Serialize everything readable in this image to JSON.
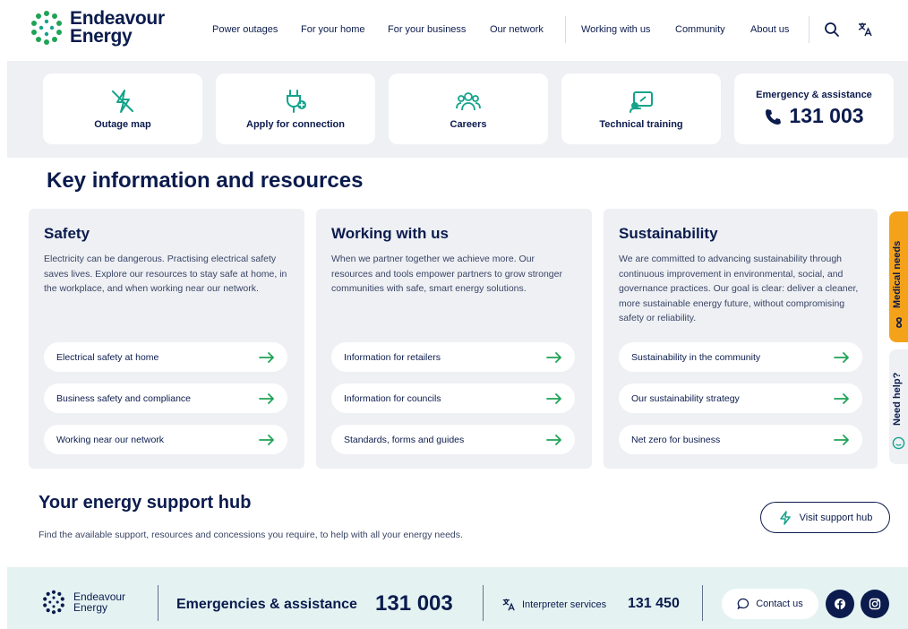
{
  "brand": {
    "name_line1": "Endeavour",
    "name_line2": "Energy"
  },
  "nav": {
    "items": [
      "Power outages",
      "For your home",
      "For your business",
      "Our network",
      "Working with us",
      "Community",
      "About us"
    ]
  },
  "header_icons": {
    "search": "search-icon",
    "translate": "translate-icon"
  },
  "quick_links": [
    {
      "label": "Outage map",
      "icon": "outage-icon"
    },
    {
      "label": "Apply for connection",
      "icon": "plug-icon"
    },
    {
      "label": "Careers",
      "icon": "people-icon"
    },
    {
      "label": "Technical training",
      "icon": "training-icon"
    }
  ],
  "emergency": {
    "title": "Emergency & assistance",
    "phone": "131 003"
  },
  "key_info": {
    "title": "Key information and resources",
    "cards": [
      {
        "title": "Safety",
        "desc": "Electricity can be dangerous. Practising electrical safety saves lives. Explore our resources to stay safe at home, in the workplace, and when working near our network.",
        "links": [
          "Electrical safety at home",
          "Business safety and compliance",
          "Working near our network"
        ]
      },
      {
        "title": "Working with us",
        "desc": "When we partner together we achieve more. Our resources and tools empower partners to grow stronger communities with safe, smart energy solutions.",
        "links": [
          "Information for retailers",
          "Information for councils",
          "Standards, forms and guides"
        ]
      },
      {
        "title": "Sustainability",
        "desc": "We are committed to advancing sustainability through continuous improvement in environmental, social, and governance practices. Our goal is clear: deliver a cleaner, more sustainable energy future, without compromising safety or reliability.",
        "links": [
          "Sustainability in the community",
          "Our sustainability strategy",
          "Net zero for business"
        ]
      }
    ]
  },
  "side_tabs": {
    "medical": "Medical needs",
    "help": "Need help?"
  },
  "support_hub": {
    "title": "Your energy support hub",
    "desc": "Find the available support, resources and concessions you require, to help with all your energy needs.",
    "button": "Visit support hub"
  },
  "footer": {
    "brand_line1": "Endeavour",
    "brand_line2": "Energy",
    "emergency_label": "Emergencies & assistance",
    "emergency_phone": "131 003",
    "interpreter_label": "Interpreter services",
    "interpreter_phone": "131 450",
    "contact_label": "Contact us",
    "social": [
      "facebook-icon",
      "instagram-icon"
    ]
  },
  "colors": {
    "navy": "#0b1b4d",
    "green": "#1fa356",
    "teal": "#14a38b",
    "orange": "#f5a21b",
    "panel": "#eef0f4"
  }
}
